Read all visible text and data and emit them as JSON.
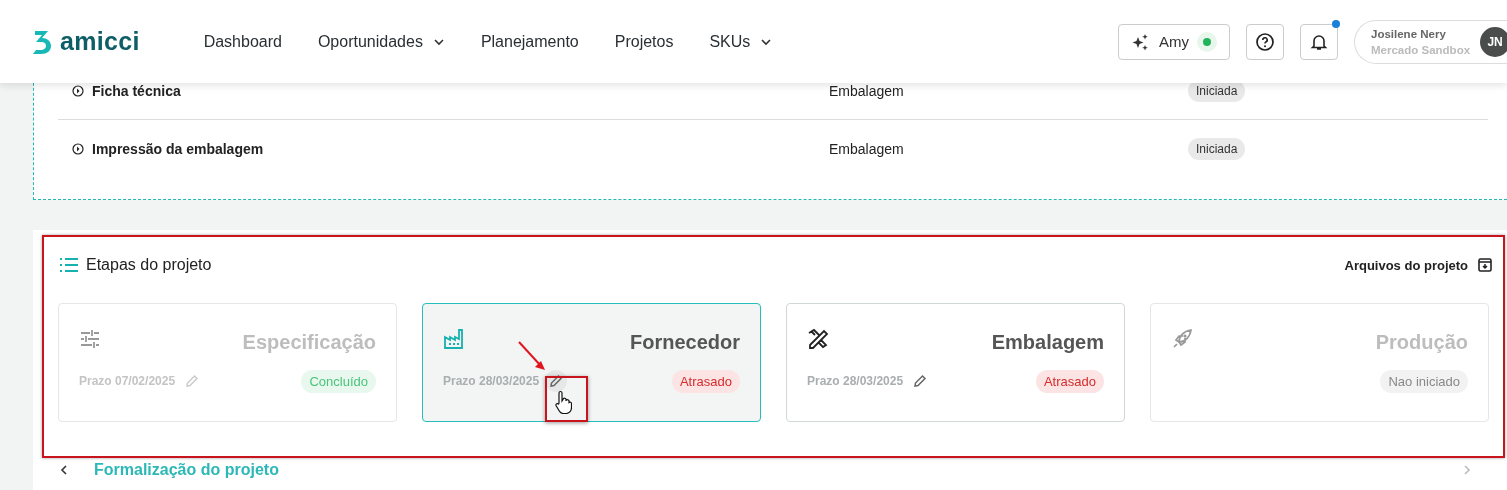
{
  "header": {
    "logo": "amicci",
    "nav": [
      {
        "label": "Dashboard",
        "dropdown": false
      },
      {
        "label": "Oportunidades",
        "dropdown": true
      },
      {
        "label": "Planejamento",
        "dropdown": false
      },
      {
        "label": "Projetos",
        "dropdown": false
      },
      {
        "label": "SKUs",
        "dropdown": true
      }
    ],
    "assistant": {
      "label": "Amy",
      "online": true
    },
    "notifications": {
      "unread": true
    },
    "user": {
      "name": "Josilene Nery",
      "org": "Mercado Sandbox",
      "initials": "JN"
    }
  },
  "tasks": [
    {
      "name": "Ficha técnica",
      "category": "Embalagem",
      "status": "Iniciada"
    },
    {
      "name": "Impressão da embalagem",
      "category": "Embalagem",
      "status": "Iniciada"
    }
  ],
  "stages": {
    "title": "Etapas do projeto",
    "files_link": "Arquivos do projeto",
    "items": [
      {
        "title": "Especificação",
        "deadline": "Prazo 07/02/2025",
        "status": {
          "label": "Concluído",
          "kind": "done"
        },
        "muted": true,
        "selected": false
      },
      {
        "title": "Fornecedor",
        "deadline": "Prazo 28/03/2025",
        "status": {
          "label": "Atrasado",
          "kind": "late"
        },
        "muted": false,
        "selected": true
      },
      {
        "title": "Embalagem",
        "deadline": "Prazo 28/03/2025",
        "status": {
          "label": "Atrasado",
          "kind": "late"
        },
        "muted": false,
        "selected": false
      },
      {
        "title": "Produção",
        "status": {
          "label": "Nao iniciado",
          "kind": "not_started"
        },
        "muted": true,
        "selected": false
      }
    ]
  },
  "next_section": {
    "title": "Formalização do projeto"
  }
}
